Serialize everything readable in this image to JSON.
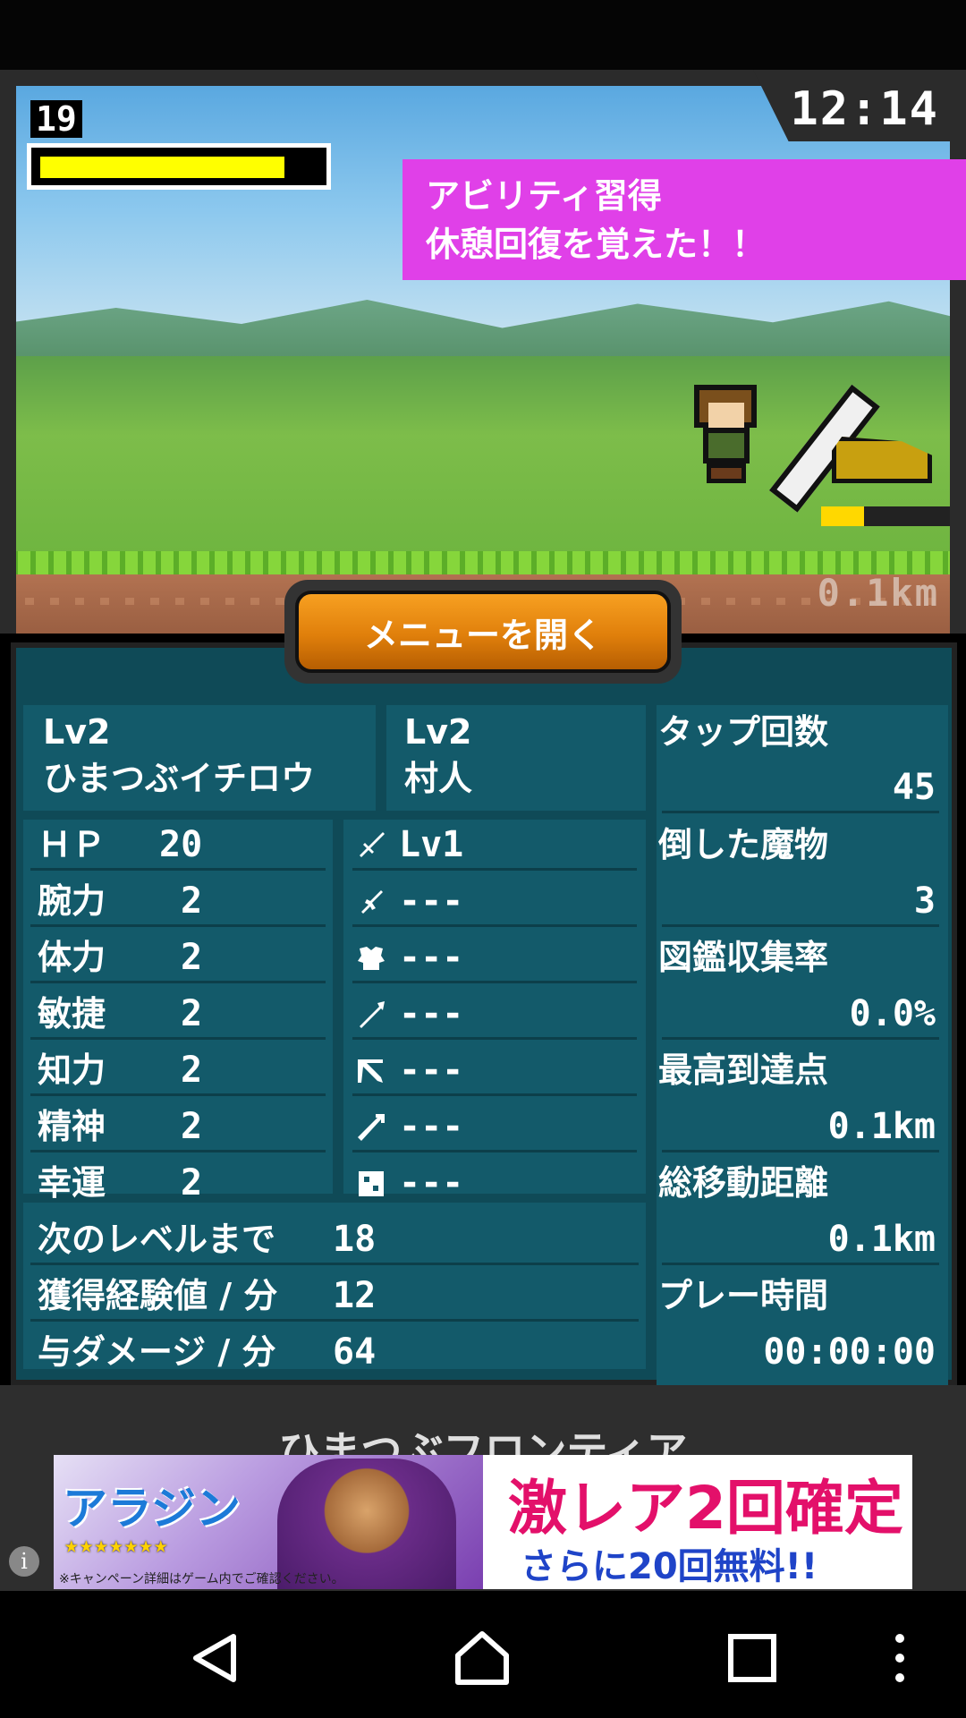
{
  "hud": {
    "level": "19",
    "hp_fill_fraction": 0.88,
    "clock": "12:14",
    "notice_line1": "アビリティ習得",
    "notice_line2": "休憩回復を覚えた！！",
    "progress_fraction": 0.33,
    "distance": "0.1km"
  },
  "menu_button": {
    "label": "メニューを開く"
  },
  "character": {
    "level": "Lv2",
    "name": "ひまつぶイチロウ",
    "job_level": "Lv2",
    "job": "村人"
  },
  "stats": [
    {
      "label": "ＨＰ",
      "value": "20"
    },
    {
      "label": "腕力",
      "value": "2"
    },
    {
      "label": "体力",
      "value": "2"
    },
    {
      "label": "敏捷",
      "value": "2"
    },
    {
      "label": "知力",
      "value": "2"
    },
    {
      "label": "精神",
      "value": "2"
    },
    {
      "label": "幸運",
      "value": "2"
    }
  ],
  "equipment": [
    {
      "icon": "sword-icon",
      "value": "Lv1"
    },
    {
      "icon": "dagger-icon",
      "value": "---"
    },
    {
      "icon": "armor-icon",
      "value": "---"
    },
    {
      "icon": "spear-icon",
      "value": "---"
    },
    {
      "icon": "bow-icon",
      "value": "---"
    },
    {
      "icon": "wand-icon",
      "value": "---"
    },
    {
      "icon": "dice-icon",
      "value": "---"
    }
  ],
  "progress_stats": [
    {
      "label": "次のレベルまで",
      "value": "18"
    },
    {
      "label": "獲得経験値 / 分",
      "value": "12"
    },
    {
      "label": "与ダメージ / 分",
      "value": "64"
    }
  ],
  "records": [
    {
      "label": "タップ回数",
      "value": "45"
    },
    {
      "label": "倒した魔物",
      "value": "3"
    },
    {
      "label": "図鑑収集率",
      "value": "0.0%"
    },
    {
      "label": "最高到達点",
      "value": "0.1km"
    },
    {
      "label": "総移動距離",
      "value": "0.1km"
    },
    {
      "label": "プレー時間",
      "value": "00:00:00"
    }
  ],
  "ad": {
    "game_title": "ひまつぶフロンティア",
    "brand": "アラジン",
    "stars": "★★★★★★★",
    "note": "※キャンペーン詳細はゲーム内でご確認ください。",
    "headline": "激レア2回確定",
    "subline": "さらに20回無料!!"
  },
  "colors": {
    "hp": "#ffff00",
    "notice": "#e040e8",
    "panel": "#0f4a57",
    "button": "#e07f0b"
  }
}
